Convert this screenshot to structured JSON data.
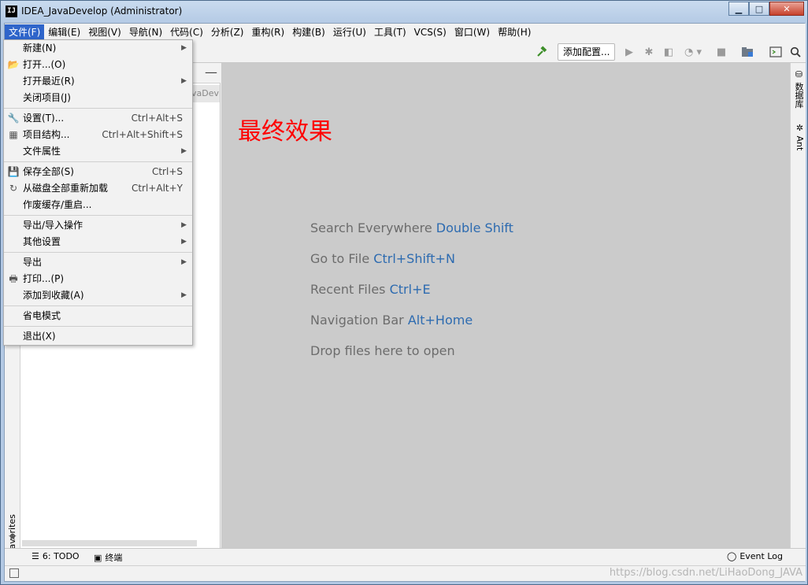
{
  "window": {
    "title": "IDEA_JavaDevelop (Administrator)",
    "app_icon_text": "IJ",
    "minimize": "▁",
    "maximize": "□",
    "close": "✕"
  },
  "menubar": {
    "items": [
      "文件(F)",
      "编辑(E)",
      "视图(V)",
      "导航(N)",
      "代码(C)",
      "分析(Z)",
      "重构(R)",
      "构建(B)",
      "运行(U)",
      "工具(T)",
      "VCS(S)",
      "窗口(W)",
      "帮助(H)"
    ],
    "active_index": 0
  },
  "toolbar": {
    "add_config_label": "添加配置..."
  },
  "project_panel": {
    "tab_fragment": "vaDev"
  },
  "editor": {
    "overlay_text": "最终效果",
    "hints": [
      {
        "text": "Search Everywhere",
        "key": "Double Shift"
      },
      {
        "text": "Go to File",
        "key": "Ctrl+Shift+N"
      },
      {
        "text": "Recent Files",
        "key": "Ctrl+E"
      },
      {
        "text": "Navigation Bar",
        "key": "Alt+Home"
      },
      {
        "text": "Drop files here to open",
        "key": ""
      }
    ]
  },
  "right_stripe": {
    "database": "数据库",
    "ant": "Ant"
  },
  "left_stripe": {
    "favorites": "2: Favorites"
  },
  "bottom_tools": {
    "todo": "6: TODO",
    "terminal": "终端",
    "event_log": "Event Log"
  },
  "statusbar": {
    "watermark": "https://blog.csdn.net/LiHaoDong_JAVA"
  },
  "file_menu": {
    "new": "新建(N)",
    "open": "打开...(O)",
    "recent": "打开最近(R)",
    "close_project": "关闭项目(J)",
    "settings": "设置(T)...",
    "settings_sc": "Ctrl+Alt+S",
    "project_structure": "项目结构...",
    "project_structure_sc": "Ctrl+Alt+Shift+S",
    "file_properties": "文件属性",
    "save_all": "保存全部(S)",
    "save_all_sc": "Ctrl+S",
    "reload": "从磁盘全部重新加载",
    "reload_sc": "Ctrl+Alt+Y",
    "invalidate": "作废缓存/重启...",
    "import_export": "导出/导入操作",
    "other_settings": "其他设置",
    "export": "导出",
    "print": "打印...(P)",
    "add_favorites": "添加到收藏(A)",
    "power_save": "省电模式",
    "exit": "退出(X)"
  },
  "colors": {
    "menu_active": "#2f65ca",
    "hint_key": "#2d6bb0",
    "overlay_red": "#ff0000",
    "editor_bg": "#cbcbcb"
  }
}
